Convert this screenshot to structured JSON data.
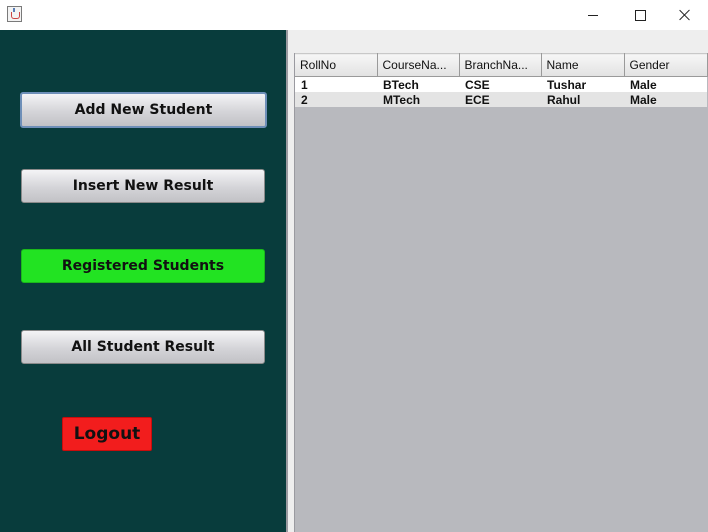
{
  "window": {
    "icon": "java-icon",
    "controls": {
      "minimize": "minimize-icon",
      "maximize": "maximize-icon",
      "close": "close-icon"
    }
  },
  "sidebar": {
    "buttons": [
      {
        "label": "Add New Student",
        "state": "focused"
      },
      {
        "label": "Insert New Result",
        "state": "normal"
      },
      {
        "label": "Registered Students",
        "state": "active"
      },
      {
        "label": "All Student Result",
        "state": "normal"
      }
    ],
    "logout_label": "Logout"
  },
  "table": {
    "columns": [
      "RollNo",
      "CourseNa...",
      "BranchNa...",
      "Name",
      "Gender"
    ],
    "rows": [
      [
        "1",
        "BTech",
        "CSE",
        "Tushar",
        "Male"
      ],
      [
        "2",
        "MTech",
        "ECE",
        "Rahul",
        "Male"
      ]
    ]
  },
  "colors": {
    "sidebar_bg": "#083c3c",
    "active_button": "#22e322",
    "logout_button": "#f21d1d",
    "table_area_bg": "#b8b9be"
  }
}
